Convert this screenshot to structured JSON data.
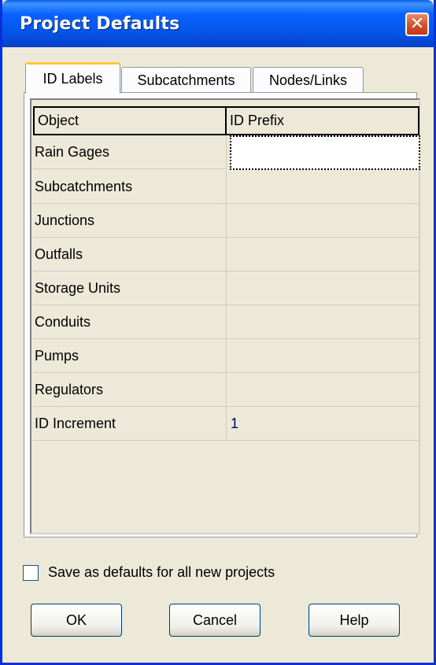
{
  "window": {
    "title": "Project Defaults",
    "close_symbol": "✕"
  },
  "tabs": [
    {
      "label": "ID Labels",
      "active": true
    },
    {
      "label": "Subcatchments",
      "active": false
    },
    {
      "label": "Nodes/Links",
      "active": false
    }
  ],
  "grid": {
    "columns": [
      "Object",
      "ID Prefix"
    ],
    "rows": [
      {
        "object": "Rain Gages",
        "value": ""
      },
      {
        "object": "Subcatchments",
        "value": ""
      },
      {
        "object": "Junctions",
        "value": ""
      },
      {
        "object": "Outfalls",
        "value": ""
      },
      {
        "object": "Storage Units",
        "value": ""
      },
      {
        "object": "Conduits",
        "value": ""
      },
      {
        "object": "Pumps",
        "value": ""
      },
      {
        "object": "Regulators",
        "value": ""
      },
      {
        "object": "ID Increment",
        "value": "1"
      }
    ]
  },
  "save_defaults": {
    "label": "Save as defaults for all new projects",
    "checked": false
  },
  "buttons": {
    "ok": "OK",
    "cancel": "Cancel",
    "help": "Help"
  },
  "colors": {
    "title_bar": "#0b61ff",
    "value_text": "#000080",
    "active_tab_accent": "#ffc83c"
  }
}
